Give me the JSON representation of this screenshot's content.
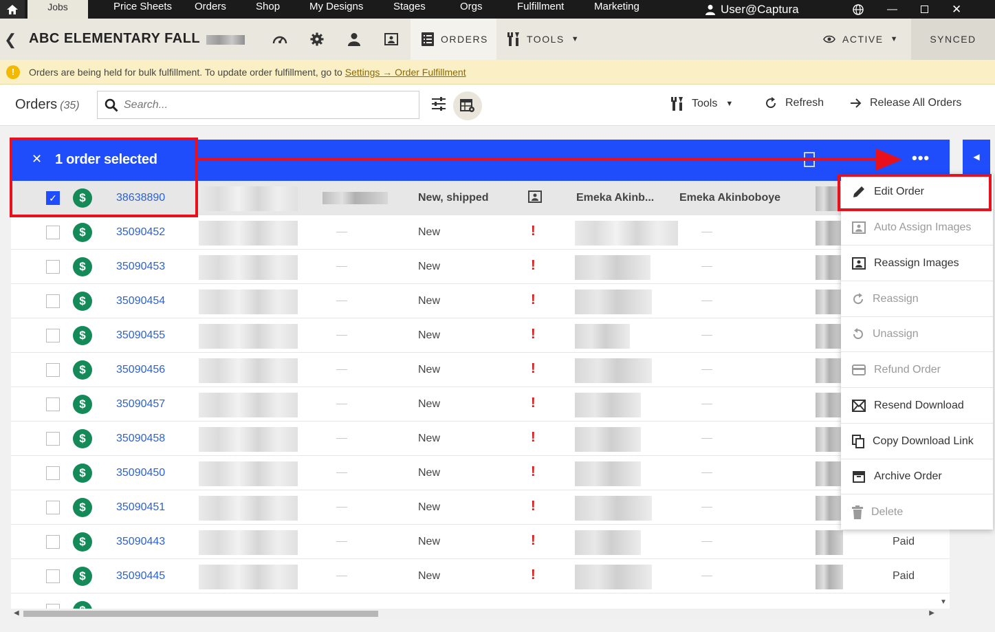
{
  "topnav": {
    "active_tab": "Jobs",
    "items": [
      "Price Sheets",
      "Orders",
      "Shop",
      "My Designs",
      "Stages",
      "Orgs",
      "Fulfillment",
      "Marketing"
    ],
    "user": "User@Captura"
  },
  "header": {
    "job_title": "ABC ELEMENTARY FALL",
    "orders_tab": "ORDERS",
    "tools_tab": "TOOLS",
    "status": "ACTIVE",
    "sync": "SYNCED"
  },
  "notice": {
    "text": "Orders are being held for bulk fulfillment. To update order fulfillment, go to",
    "link": "Settings → Order Fulfillment"
  },
  "toolbar": {
    "title": "Orders",
    "count": "(35)",
    "search_placeholder": "Search...",
    "tools": "Tools",
    "refresh": "Refresh",
    "release": "Release All Orders"
  },
  "selection": {
    "label": "1 order selected",
    "more": "•••"
  },
  "rows": [
    {
      "order": "38638890",
      "status": "New, shipped",
      "customer": "Emeka Akinb...",
      "customer_full": "Emeka Akinboboye",
      "selected": true
    },
    {
      "order": "35090452",
      "status": "New",
      "paid": ""
    },
    {
      "order": "35090453",
      "status": "New",
      "paid": ""
    },
    {
      "order": "35090454",
      "status": "New",
      "paid": ""
    },
    {
      "order": "35090455",
      "status": "New",
      "paid": ""
    },
    {
      "order": "35090456",
      "status": "New",
      "paid": ""
    },
    {
      "order": "35090457",
      "status": "New",
      "paid": ""
    },
    {
      "order": "35090458",
      "status": "New",
      "paid": ""
    },
    {
      "order": "35090450",
      "status": "New",
      "paid": ""
    },
    {
      "order": "35090451",
      "status": "New",
      "paid": ""
    },
    {
      "order": "35090443",
      "status": "New",
      "paid": "Paid"
    },
    {
      "order": "35090445",
      "status": "New",
      "paid": "Paid"
    }
  ],
  "menu": {
    "items": [
      {
        "label": "Edit Order",
        "icon": "pencil-icon",
        "enabled": true
      },
      {
        "label": "Auto Assign Images",
        "icon": "image-icon",
        "enabled": false
      },
      {
        "label": "Reassign Images",
        "icon": "image-icon",
        "enabled": true
      },
      {
        "label": "Reassign",
        "icon": "redo-icon",
        "enabled": false
      },
      {
        "label": "Unassign",
        "icon": "undo-icon",
        "enabled": false
      },
      {
        "label": "Refund Order",
        "icon": "card-icon",
        "enabled": false
      },
      {
        "label": "Resend Download",
        "icon": "mail-icon",
        "enabled": true
      },
      {
        "label": "Copy Download Link",
        "icon": "copy-icon",
        "enabled": true
      },
      {
        "label": "Archive Order",
        "icon": "archive-icon",
        "enabled": true
      },
      {
        "label": "Delete",
        "icon": "trash-icon",
        "enabled": false
      }
    ]
  },
  "colors": {
    "accent_blue": "#1f4dfb",
    "annotation_red": "#e8101a",
    "paid_green": "#138a58",
    "alert_red": "#d91a1a"
  }
}
